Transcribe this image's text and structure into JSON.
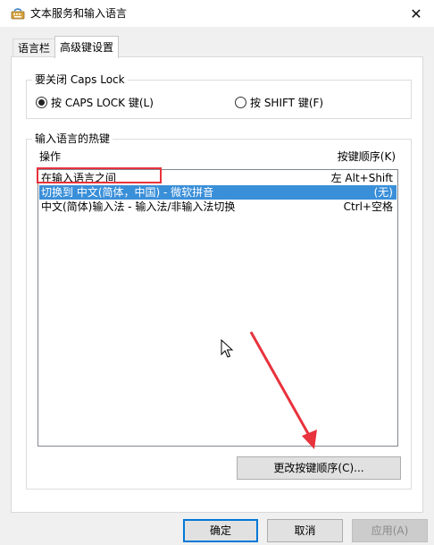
{
  "window": {
    "title": "文本服务和输入语言",
    "close_glyph": "✕"
  },
  "tabs": [
    {
      "label": "语言栏",
      "active": false
    },
    {
      "label": "高级键设置",
      "active": true
    }
  ],
  "caps_lock_group": {
    "title": "要关闭 Caps Lock",
    "options": [
      {
        "label": "按 CAPS LOCK 键(L)",
        "checked": true
      },
      {
        "label": "按 SHIFT 键(F)",
        "checked": false
      }
    ]
  },
  "hotkeys_group": {
    "title": "输入语言的热键",
    "column_action": "操作",
    "column_key": "按键顺序(K)",
    "rows": [
      {
        "action": "在输入语言之间",
        "key": "左 Alt+Shift",
        "selected": false
      },
      {
        "action": "切换到 中文(简体，中国) - 微软拼音",
        "key": "(无)",
        "selected": true
      },
      {
        "action": "中文(简体)输入法 - 输入法/非输入法切换",
        "key": "Ctrl+空格",
        "selected": false
      }
    ],
    "change_button": "更改按键顺序(C)..."
  },
  "footer": {
    "ok": "确定",
    "cancel": "取消",
    "apply": "应用(A)"
  },
  "colors": {
    "selection": "#3a8fd9",
    "annotation_red": "#e8323c",
    "primary_border": "#0078d7"
  }
}
